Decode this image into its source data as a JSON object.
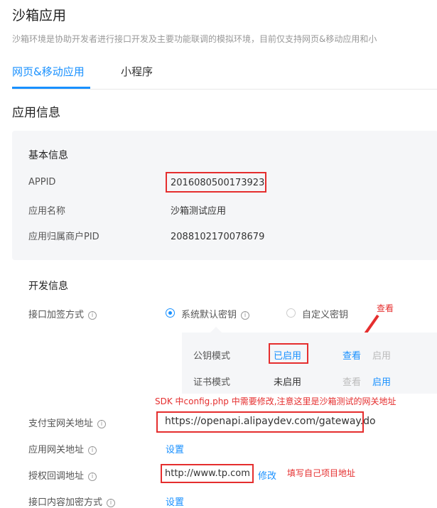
{
  "page": {
    "title": "沙箱应用",
    "subtitle": "沙箱环境是协助开发者进行接口开发及主要功能联调的模拟环境，目前仅支持网页&移动应用和小"
  },
  "tabs": [
    {
      "label": "网页&移动应用",
      "active": true
    },
    {
      "label": "小程序",
      "active": false
    }
  ],
  "app_info": {
    "title": "应用信息",
    "basic": {
      "title": "基本信息",
      "appid_label": "APPID",
      "appid_value": "2016080500173923",
      "name_label": "应用名称",
      "name_value": "沙箱测试应用",
      "pid_label": "应用归属商户PID",
      "pid_value": "2088102170078679"
    }
  },
  "dev_info": {
    "title": "开发信息",
    "sign_label": "接口加签方式",
    "sign_options": [
      {
        "label": "系统默认密钥",
        "checked": true
      },
      {
        "label": "自定义密钥",
        "checked": false
      }
    ],
    "key_modes": [
      {
        "mode": "公钥模式",
        "status": "已启用",
        "view": "查看",
        "action": "启用",
        "view_enabled": true,
        "action_enabled": false
      },
      {
        "mode": "证书模式",
        "status": "未启用",
        "view": "查看",
        "action": "启用",
        "view_enabled": false,
        "action_enabled": true
      }
    ],
    "gateway_label": "支付宝网关地址",
    "gateway_value": "https://openapi.alipaydev.com/gateway.do",
    "app_gateway_label": "应用网关地址",
    "app_gateway_action": "设置",
    "callback_label": "授权回调地址",
    "callback_value": "http://www.tp.com",
    "callback_action": "修改",
    "encrypt_label": "接口内容加密方式",
    "encrypt_action": "设置"
  },
  "annotations": {
    "view_note": "查看",
    "sdk_note": "SDK 中config.php 中需要修改,注意这里是沙箱测试的网关地址",
    "callback_note": "填写自己项目地址"
  },
  "colors": {
    "accent": "#1890ff",
    "annotation": "#e52e2e",
    "card_bg": "#f5f6f8"
  }
}
